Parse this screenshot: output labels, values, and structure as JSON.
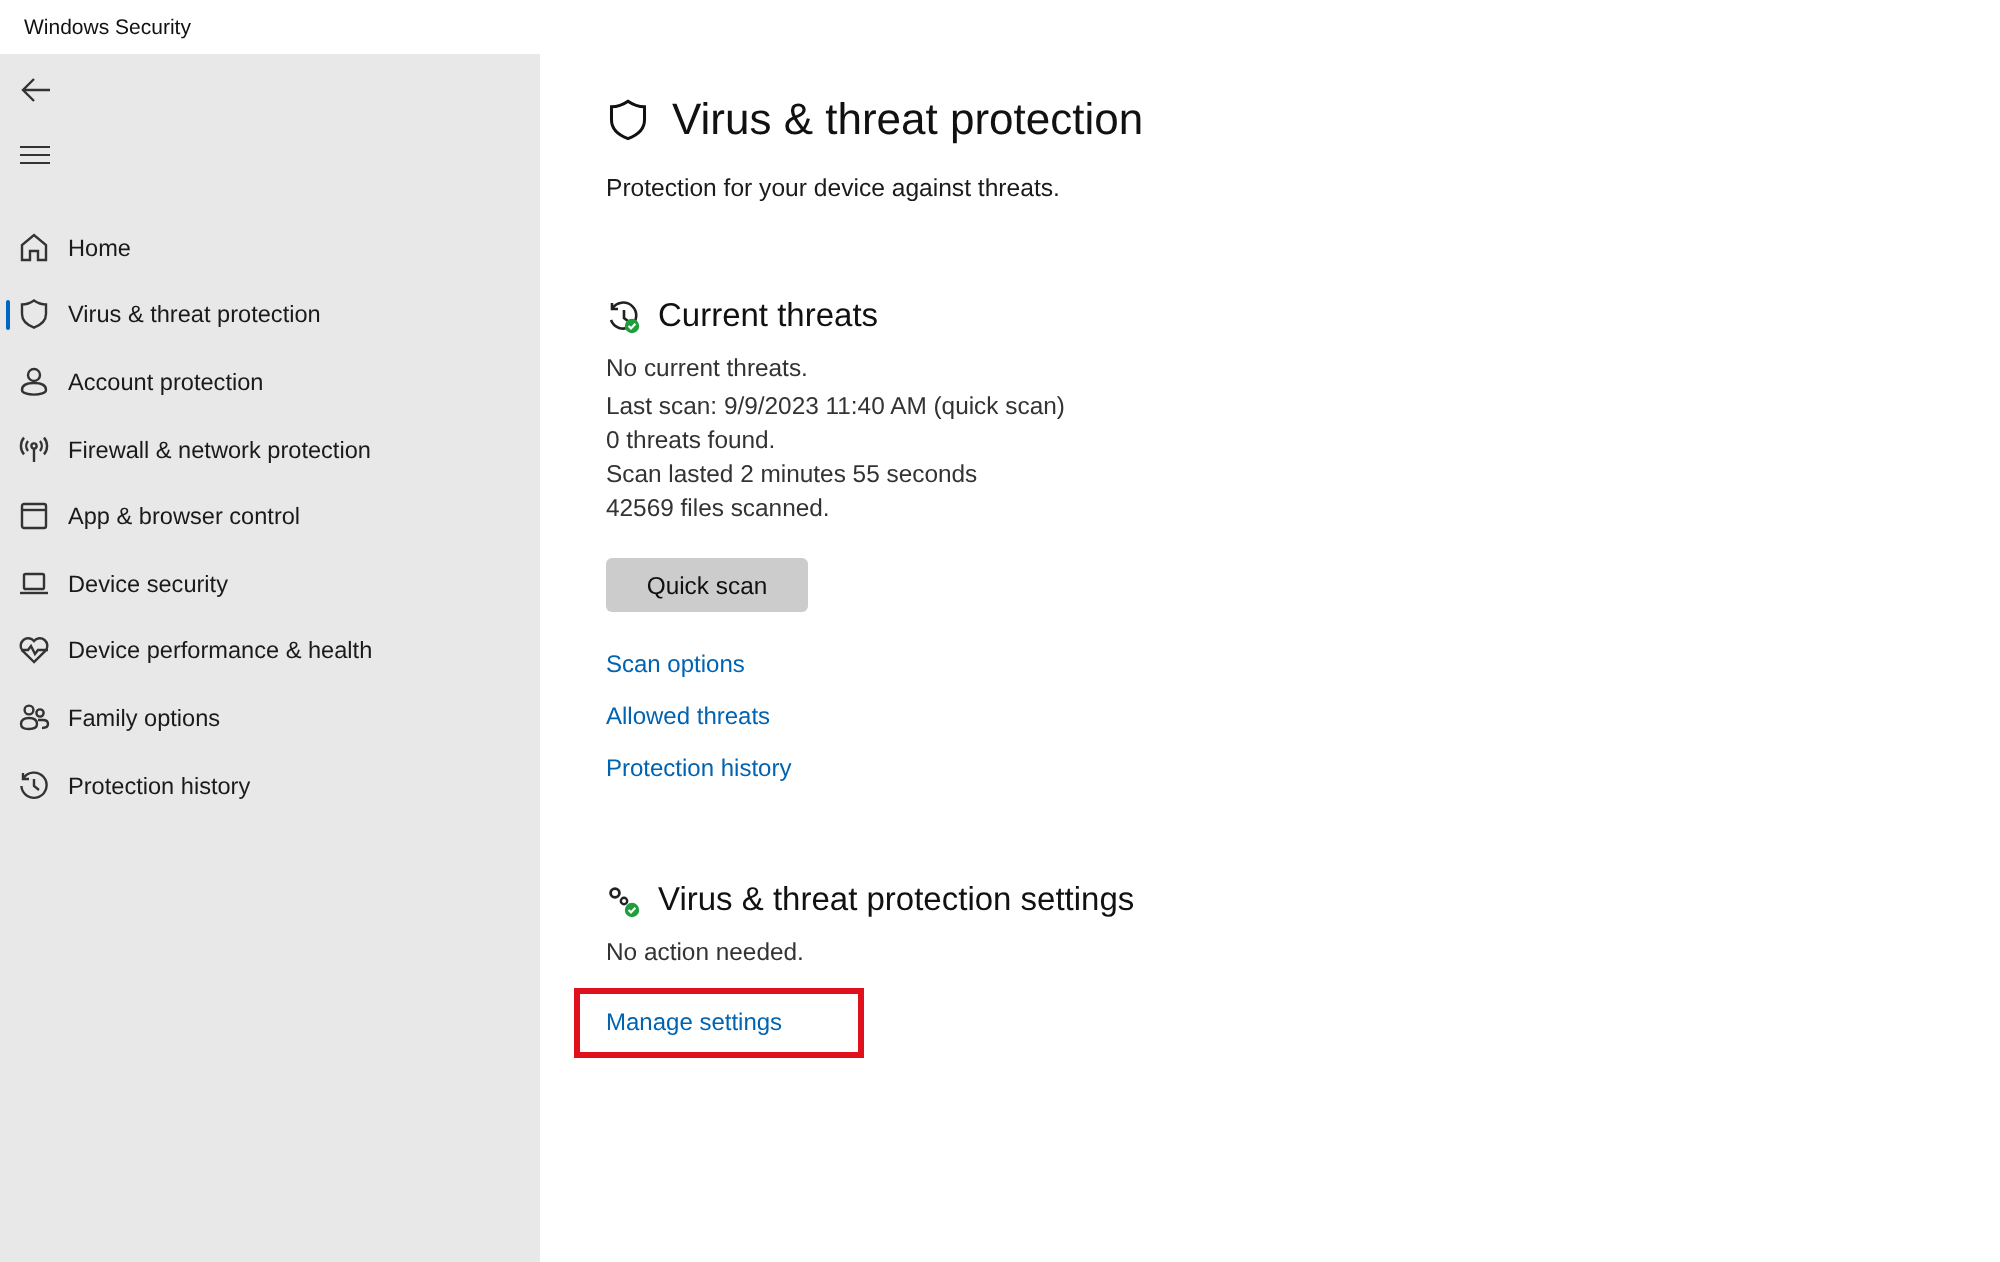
{
  "window": {
    "title": "Windows Security"
  },
  "sidebar": {
    "items": [
      {
        "label": "Home",
        "selected": false
      },
      {
        "label": "Virus & threat protection",
        "selected": true
      },
      {
        "label": "Account protection",
        "selected": false
      },
      {
        "label": "Firewall & network protection",
        "selected": false
      },
      {
        "label": "App & browser control",
        "selected": false
      },
      {
        "label": "Device security",
        "selected": false
      },
      {
        "label": "Device performance & health",
        "selected": false
      },
      {
        "label": "Family options",
        "selected": false
      },
      {
        "label": "Protection history",
        "selected": false
      }
    ]
  },
  "page": {
    "title": "Virus & threat protection",
    "subtitle": "Protection for your device against threats."
  },
  "current_threats": {
    "title": "Current threats",
    "lines": [
      "No current threats.",
      "Last scan: 9/9/2023 11:40 AM (quick scan)",
      "0 threats found.",
      "Scan lasted 2 minutes 55 seconds",
      "42569 files scanned."
    ],
    "button": "Quick scan",
    "links": [
      {
        "label": "Scan options",
        "highlighted": false
      },
      {
        "label": "Allowed threats",
        "highlighted": false
      },
      {
        "label": "Protection history",
        "highlighted": false
      }
    ]
  },
  "settings": {
    "title": "Virus & threat protection settings",
    "status": "No action needed.",
    "links": [
      {
        "label": "Manage settings",
        "highlighted": true
      }
    ]
  }
}
